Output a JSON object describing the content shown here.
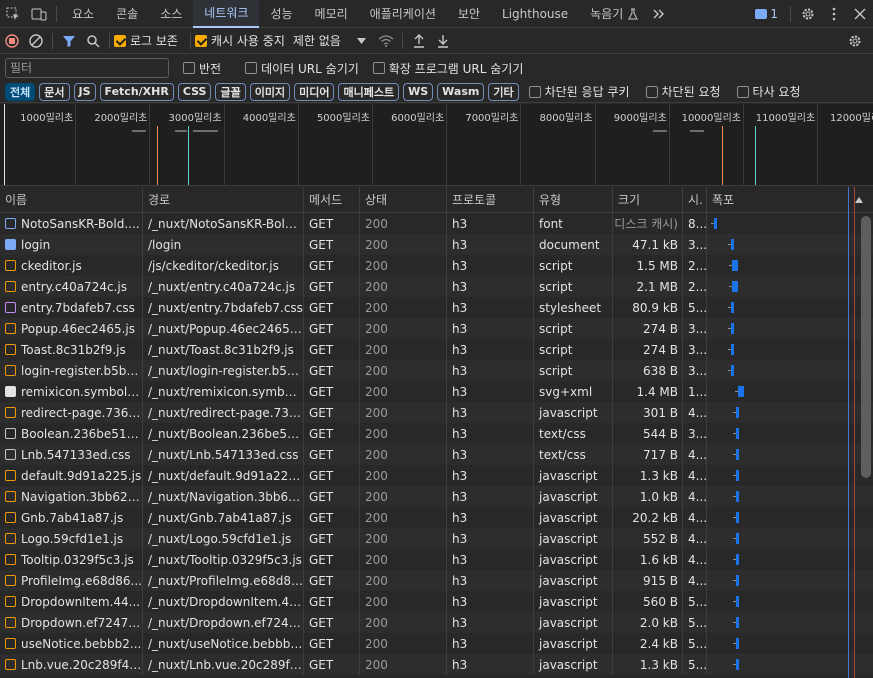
{
  "tabs": [
    "요소",
    "콘솔",
    "소스",
    "네트워크",
    "성능",
    "메모리",
    "애플리케이션",
    "보안",
    "Lighthouse",
    "녹음기"
  ],
  "active_tab": "네트워크",
  "badge_count": "1",
  "toolbar": {
    "preserve_log": "로그 보존",
    "disable_cache": "캐시 사용 중지",
    "throttle": "제한 없음"
  },
  "filter": {
    "placeholder": "필터",
    "invert": "반전",
    "hide_data_urls": "데이터 URL 숨기기",
    "hide_ext_urls": "확장 프로그램 URL 숨기기"
  },
  "types": [
    "전체",
    "문서",
    "JS",
    "Fetch/XHR",
    "CSS",
    "글꼴",
    "이미지",
    "미디어",
    "매니페스트",
    "WS",
    "Wasm",
    "기타"
  ],
  "type_toggles": {
    "blocked_cookies": "차단된 응답 쿠키",
    "blocked_requests": "차단된 요청",
    "third_party": "타사 요청"
  },
  "overview_labels": [
    "1000밀리초",
    "2000밀리초",
    "3000밀리초",
    "4000밀리초",
    "5000밀리초",
    "6000밀리초",
    "7000밀리초",
    "8000밀리초",
    "9000밀리초",
    "10000밀리초",
    "11000밀리초",
    "12000밀리초"
  ],
  "columns": {
    "name": "이름",
    "path": "경로",
    "method": "메서드",
    "status": "상태",
    "protocol": "프로토콜",
    "type": "유형",
    "size": "크기",
    "time": "시.",
    "waterfall": "폭포"
  },
  "rows": [
    {
      "name": "NotoSansKR-Bold....",
      "path": "/_nuxt/NotoSansKR-Bold....",
      "method": "GET",
      "status": "200",
      "protocol": "h3",
      "type": "font",
      "size": "(디스크 캐시)",
      "time": "8...",
      "icon": "font",
      "wf": 0.02
    },
    {
      "name": "login",
      "path": "/login",
      "method": "GET",
      "status": "200",
      "protocol": "h3",
      "type": "document",
      "size": "47.1 kB",
      "time": "3...",
      "icon": "doc",
      "wf": 0.14
    },
    {
      "name": "ckeditor.js",
      "path": "/js/ckeditor/ckeditor.js",
      "method": "GET",
      "status": "200",
      "protocol": "h3",
      "type": "script",
      "size": "1.5 MB",
      "time": "2...",
      "icon": "script",
      "wf": 0.15
    },
    {
      "name": "entry.c40a724c.js",
      "path": "/_nuxt/entry.c40a724c.js",
      "method": "GET",
      "status": "200",
      "protocol": "h3",
      "type": "script",
      "size": "2.1 MB",
      "time": "2...",
      "icon": "script",
      "wf": 0.15
    },
    {
      "name": "entry.7bdafeb7.css",
      "path": "/_nuxt/entry.7bdafeb7.css",
      "method": "GET",
      "status": "200",
      "protocol": "h3",
      "type": "stylesheet",
      "size": "80.9 kB",
      "time": "5...",
      "icon": "css",
      "wf": 0.14
    },
    {
      "name": "Popup.46ec2465.js",
      "path": "/_nuxt/Popup.46ec2465.js",
      "method": "GET",
      "status": "200",
      "protocol": "h3",
      "type": "script",
      "size": "274 B",
      "time": "3...",
      "icon": "script",
      "wf": 0.14
    },
    {
      "name": "Toast.8c31b2f9.js",
      "path": "/_nuxt/Toast.8c31b2f9.js",
      "method": "GET",
      "status": "200",
      "protocol": "h3",
      "type": "script",
      "size": "274 B",
      "time": "3...",
      "icon": "script",
      "wf": 0.14
    },
    {
      "name": "login-register.b5ba...",
      "path": "/_nuxt/login-register.b5ba...",
      "method": "GET",
      "status": "200",
      "protocol": "h3",
      "type": "script",
      "size": "638 B",
      "time": "3...",
      "icon": "script",
      "wf": 0.14
    },
    {
      "name": "remixicon.symbol....",
      "path": "/_nuxt/remixicon.symbol....",
      "method": "GET",
      "status": "200",
      "protocol": "h3",
      "type": "svg+xml",
      "size": "1.4 MB",
      "time": "1...",
      "icon": "svg",
      "wf": 0.19
    },
    {
      "name": "redirect-page.7360...",
      "path": "/_nuxt/redirect-page.736...",
      "method": "GET",
      "status": "200",
      "protocol": "h3",
      "type": "javascript",
      "size": "301 B",
      "time": "4...",
      "icon": "script",
      "wf": 0.18
    },
    {
      "name": "Boolean.236be51d...",
      "path": "/_nuxt/Boolean.236be51...",
      "method": "GET",
      "status": "200",
      "protocol": "h3",
      "type": "text/css",
      "size": "544 B",
      "time": "3...",
      "icon": "gcss",
      "wf": 0.18
    },
    {
      "name": "Lnb.547133ed.css",
      "path": "/_nuxt/Lnb.547133ed.css",
      "method": "GET",
      "status": "200",
      "protocol": "h3",
      "type": "text/css",
      "size": "717 B",
      "time": "4...",
      "icon": "gcss",
      "wf": 0.18
    },
    {
      "name": "default.9d91a225.js",
      "path": "/_nuxt/default.9d91a225.js",
      "method": "GET",
      "status": "200",
      "protocol": "h3",
      "type": "javascript",
      "size": "1.3 kB",
      "time": "4...",
      "icon": "script",
      "wf": 0.18
    },
    {
      "name": "Navigation.3bb62c...",
      "path": "/_nuxt/Navigation.3bb62...",
      "method": "GET",
      "status": "200",
      "protocol": "h3",
      "type": "javascript",
      "size": "1.0 kB",
      "time": "4...",
      "icon": "script",
      "wf": 0.18
    },
    {
      "name": "Gnb.7ab41a87.js",
      "path": "/_nuxt/Gnb.7ab41a87.js",
      "method": "GET",
      "status": "200",
      "protocol": "h3",
      "type": "javascript",
      "size": "20.2 kB",
      "time": "4...",
      "icon": "script",
      "wf": 0.18
    },
    {
      "name": "Logo.59cfd1e1.js",
      "path": "/_nuxt/Logo.59cfd1e1.js",
      "method": "GET",
      "status": "200",
      "protocol": "h3",
      "type": "javascript",
      "size": "552 B",
      "time": "4...",
      "icon": "script",
      "wf": 0.18
    },
    {
      "name": "Tooltip.0329f5c3.js",
      "path": "/_nuxt/Tooltip.0329f5c3.js",
      "method": "GET",
      "status": "200",
      "protocol": "h3",
      "type": "javascript",
      "size": "1.6 kB",
      "time": "4...",
      "icon": "script",
      "wf": 0.18
    },
    {
      "name": "ProfileImg.e68d86...",
      "path": "/_nuxt/ProfileImg.e68d86...",
      "method": "GET",
      "status": "200",
      "protocol": "h3",
      "type": "javascript",
      "size": "915 B",
      "time": "4...",
      "icon": "script",
      "wf": 0.18
    },
    {
      "name": "DropdownItem.44...",
      "path": "/_nuxt/DropdownItem.44...",
      "method": "GET",
      "status": "200",
      "protocol": "h3",
      "type": "javascript",
      "size": "560 B",
      "time": "5...",
      "icon": "script",
      "wf": 0.18
    },
    {
      "name": "Dropdown.ef7247c...",
      "path": "/_nuxt/Dropdown.ef7247...",
      "method": "GET",
      "status": "200",
      "protocol": "h3",
      "type": "javascript",
      "size": "2.0 kB",
      "time": "5...",
      "icon": "script",
      "wf": 0.18
    },
    {
      "name": "useNotice.bebbb2...",
      "path": "/_nuxt/useNotice.bebbb2...",
      "method": "GET",
      "status": "200",
      "protocol": "h3",
      "type": "javascript",
      "size": "2.4 kB",
      "time": "5...",
      "icon": "script",
      "wf": 0.18
    },
    {
      "name": "Lnb.vue.20c289f4.js",
      "path": "/_nuxt/Lnb.vue.20c289f4.js",
      "method": "GET",
      "status": "200",
      "protocol": "h3",
      "type": "javascript",
      "size": "1.3 kB",
      "time": "5...",
      "icon": "script",
      "wf": 0.18
    }
  ],
  "colors": {
    "accent": "#a8c7fa",
    "dom_content_loaded": "#5ad0c8",
    "load": "#f28b54",
    "bar": "#1a73e8"
  }
}
